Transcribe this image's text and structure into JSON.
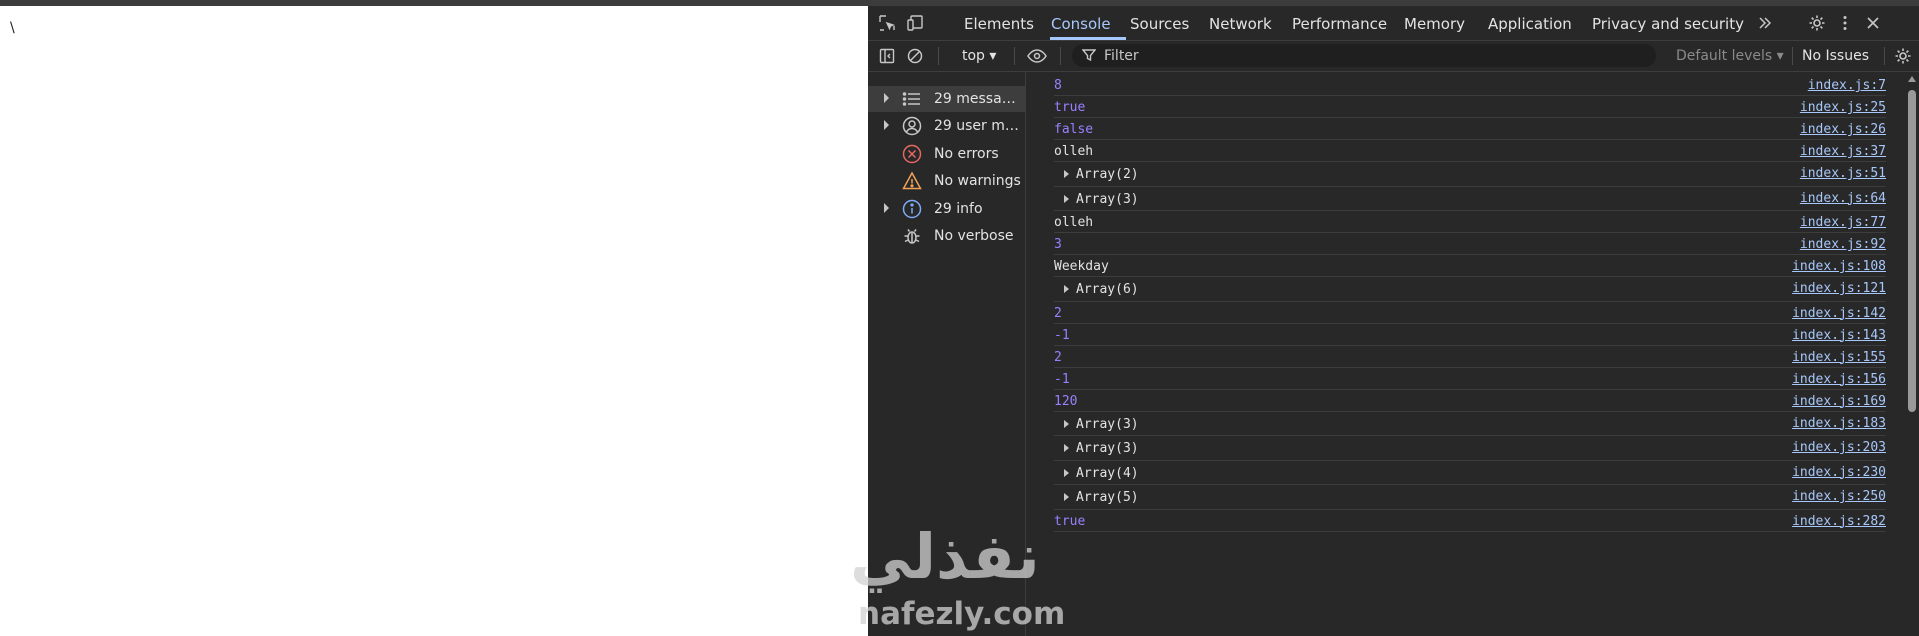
{
  "page": {
    "text": "\\"
  },
  "devtools": {
    "tabs": [
      {
        "label": "Elements"
      },
      {
        "label": "Console"
      },
      {
        "label": "Sources"
      },
      {
        "label": "Network"
      },
      {
        "label": "Performance"
      },
      {
        "label": "Memory"
      },
      {
        "label": "Application"
      },
      {
        "label": "Privacy and security"
      }
    ],
    "active_tab": "Console",
    "more_tabs_icon": "double-chevron-right-icon",
    "toolbar": {
      "context": "top ▾",
      "filter_placeholder": "Filter",
      "levels": "Default levels ▾",
      "issues": "No Issues"
    },
    "sidebar": [
      {
        "label": "29 messages",
        "icon": "list-icon",
        "expandable": true
      },
      {
        "label": "29 user messages",
        "icon": "user-icon",
        "expandable": true
      },
      {
        "label": "No errors",
        "icon": "error-icon",
        "expandable": false
      },
      {
        "label": "No warnings",
        "icon": "warning-icon",
        "expandable": false
      },
      {
        "label": "29 info",
        "icon": "info-icon",
        "expandable": true
      },
      {
        "label": "No verbose",
        "icon": "bug-icon",
        "expandable": false
      }
    ],
    "logs": [
      {
        "value": "8",
        "type": "num",
        "source": "index.js:7"
      },
      {
        "value": "true",
        "type": "bool",
        "source": "index.js:25"
      },
      {
        "value": "false",
        "type": "bool",
        "source": "index.js:26"
      },
      {
        "value": "olleh",
        "type": "str",
        "source": "index.js:37"
      },
      {
        "value": "Array(2)",
        "type": "obj",
        "source": "index.js:51"
      },
      {
        "value": "Array(3)",
        "type": "obj",
        "source": "index.js:64"
      },
      {
        "value": "olleh",
        "type": "str",
        "source": "index.js:77"
      },
      {
        "value": "3",
        "type": "num",
        "source": "index.js:92"
      },
      {
        "value": "Weekday",
        "type": "str",
        "source": "index.js:108"
      },
      {
        "value": "Array(6)",
        "type": "obj",
        "source": "index.js:121"
      },
      {
        "value": "2",
        "type": "num",
        "source": "index.js:142"
      },
      {
        "value": "-1",
        "type": "num",
        "source": "index.js:143"
      },
      {
        "value": "2",
        "type": "num",
        "source": "index.js:155"
      },
      {
        "value": "-1",
        "type": "num",
        "source": "index.js:156"
      },
      {
        "value": "120",
        "type": "num",
        "source": "index.js:169"
      },
      {
        "value": "Array(3)",
        "type": "obj",
        "source": "index.js:183"
      },
      {
        "value": "Array(3)",
        "type": "obj",
        "source": "index.js:203"
      },
      {
        "value": "Array(4)",
        "type": "obj",
        "source": "index.js:230"
      },
      {
        "value": "Array(5)",
        "type": "obj",
        "source": "index.js:250"
      },
      {
        "value": "true",
        "type": "bool",
        "source": "index.js:282"
      }
    ]
  },
  "watermark": {
    "arabic": "نفذلي",
    "latin": "nafezly.com"
  },
  "colors": {
    "panel_bg": "#282828",
    "text": "#e3e3e3",
    "accent": "#a8c7fa",
    "number": "#9980ff",
    "error": "#e46962",
    "warning": "#f0a35b",
    "info": "#7cacf8"
  }
}
